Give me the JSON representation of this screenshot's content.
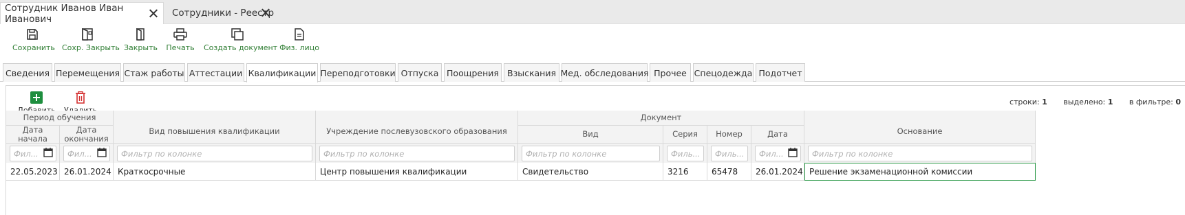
{
  "doc_tabs": [
    {
      "label": "Сотрудник Иванов Иван Иванович"
    },
    {
      "label": "Сотрудники - Реестр"
    }
  ],
  "toolbar": {
    "save": "Сохранить",
    "save_close": "Сохр. Закрыть",
    "close": "Закрыть",
    "print": "Печать",
    "create_document": "Создать документ",
    "person": "Физ. лицо"
  },
  "section_tabs": [
    {
      "label": "Сведения"
    },
    {
      "label": "Перемещения"
    },
    {
      "label": "Стаж работы"
    },
    {
      "label": "Аттестации"
    },
    {
      "label": "Квалификации"
    },
    {
      "label": "Переподготовки"
    },
    {
      "label": "Отпуска"
    },
    {
      "label": "Поощрения"
    },
    {
      "label": "Взыскания"
    },
    {
      "label": "Мед. обследования"
    },
    {
      "label": "Прочее"
    },
    {
      "label": "Спецодежда"
    },
    {
      "label": "Подотчет"
    }
  ],
  "active_section_tab": "Квалификации",
  "grid_toolbar": {
    "add": "Добавить",
    "delete": "Удалить"
  },
  "stats": {
    "rows_label": "строки:",
    "rows": "1",
    "selected_label": "выделено:",
    "selected": "1",
    "filtered_label": "в фильтре:",
    "filtered": "0"
  },
  "table": {
    "group_period": "Период обучения",
    "group_document": "Документ",
    "columns": {
      "start_date": "Дата начала",
      "end_date": "Дата окончания",
      "kind": "Вид повышения квалификации",
      "institution": "Учреждение послевузовского образования",
      "doc_type": "Вид",
      "series": "Серия",
      "number": "Номер",
      "doc_date": "Дата",
      "basis": "Основание"
    },
    "filter_placeholder_long": "Фильтр по колонке",
    "filter_placeholder_short": "Филь...",
    "filter_placeholder_date": "Фил...",
    "rows": [
      {
        "start_date": "22.05.2023",
        "end_date": "26.01.2024",
        "kind": "Краткосрочные",
        "institution": "Центр повышения квалификации",
        "doc_type": "Свидетельство",
        "series": "3216",
        "number": "65478",
        "doc_date": "26.01.2024",
        "basis": "Решение экзаменационной комиссии"
      }
    ]
  },
  "colors": {
    "accent_green": "#2e7d32",
    "add_button_green": "#1e8e3e",
    "delete_red": "#d32f2f"
  }
}
